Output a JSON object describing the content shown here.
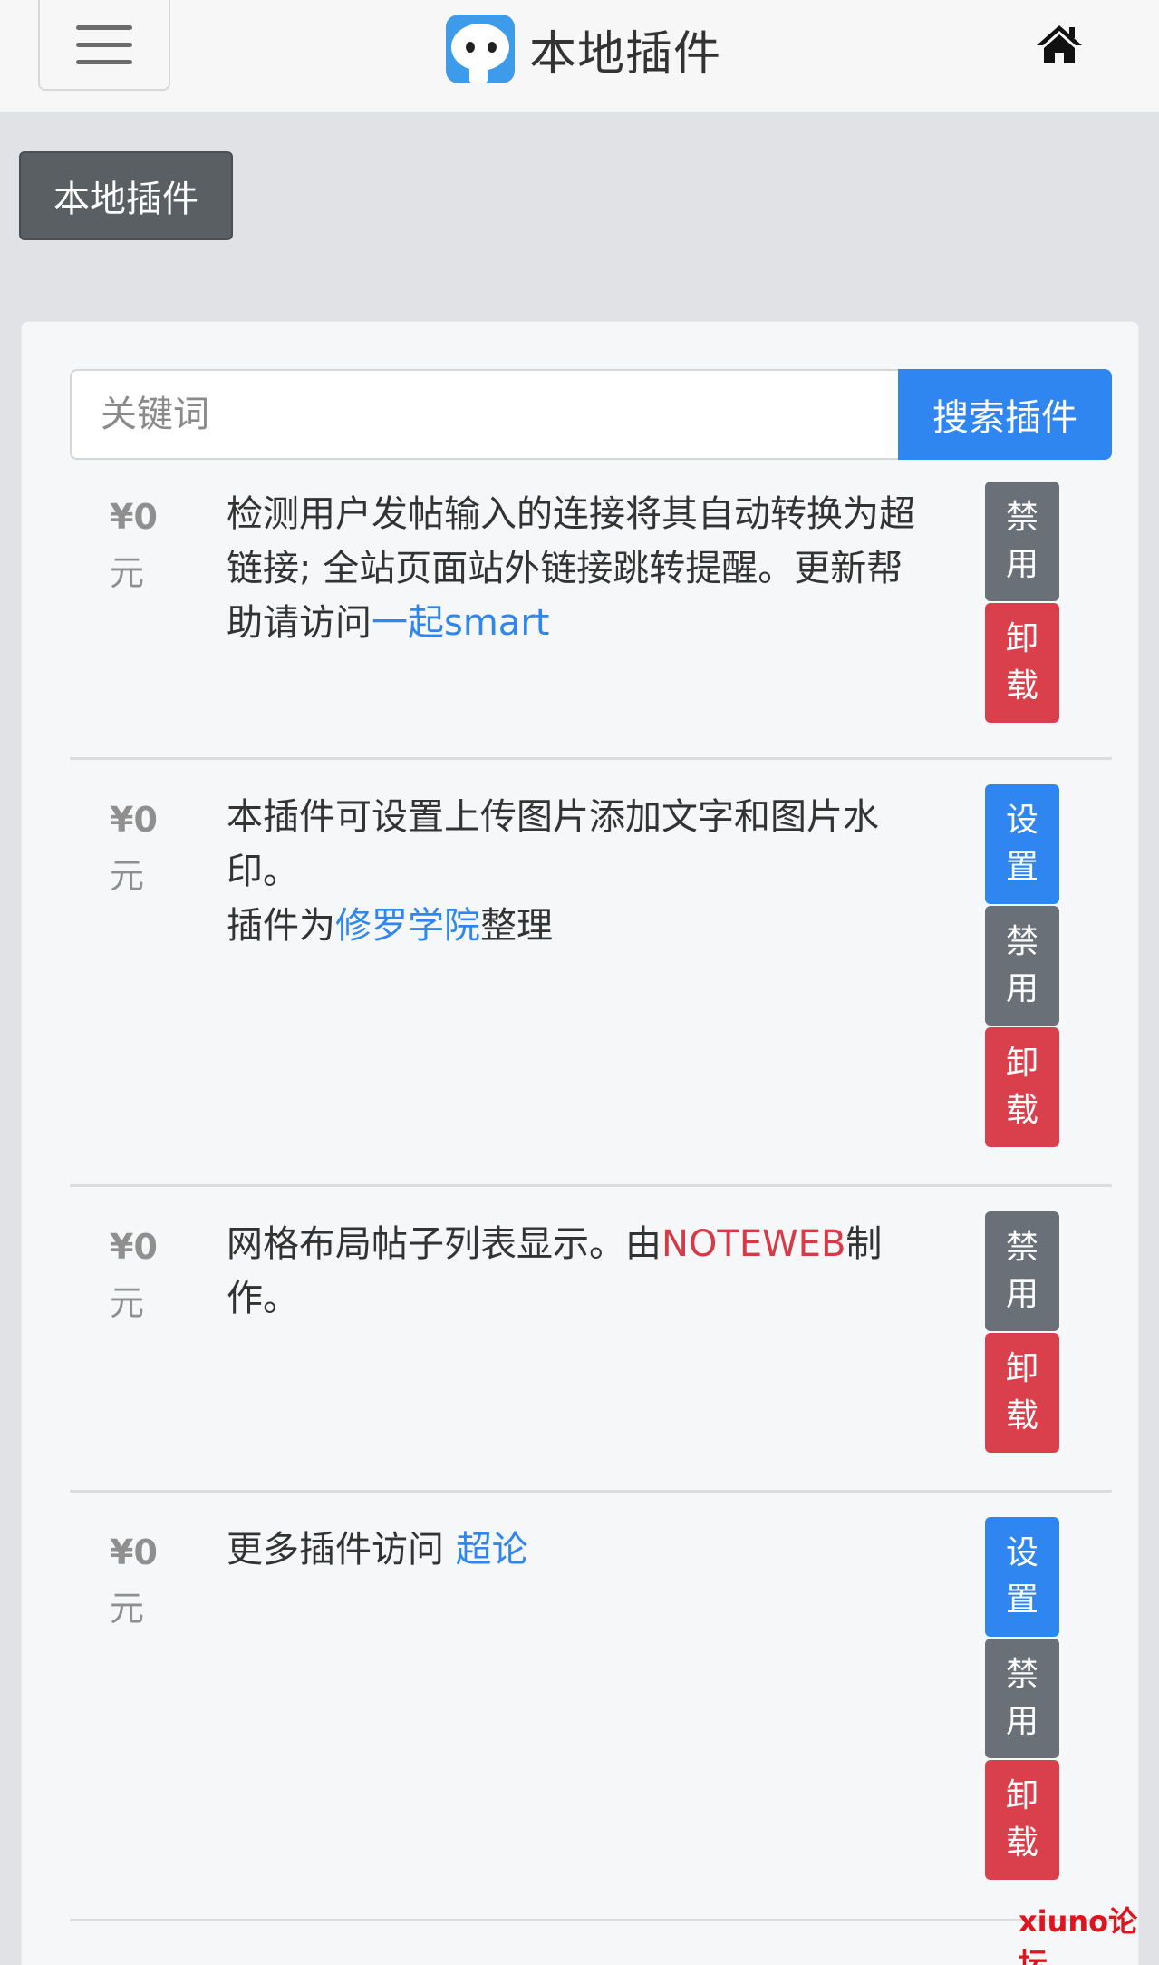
{
  "navbar": {
    "title": "本地插件",
    "menu_icon": "hamburger-menu-icon",
    "logo_icon": "chat-bubble-logo-icon",
    "home_icon": "home-icon"
  },
  "breadcrumb": {
    "label": "本地插件"
  },
  "search": {
    "placeholder": "关键词",
    "button_label": "搜索插件"
  },
  "plugins": [
    {
      "price": "¥0",
      "price_unit": "元",
      "desc_text": "检测用户发帖输入的连接将其自动转换为超链接; 全站页面站外链接跳转提醒。更新帮助请访问",
      "desc_link": "一起smart",
      "actions": [
        {
          "line1": "禁",
          "line2": "用",
          "color": "gray"
        },
        {
          "line1": "卸",
          "line2": "载",
          "color": "red"
        }
      ]
    },
    {
      "price": "¥0",
      "price_unit": "元",
      "desc_text": "本插件可设置上传图片添加文字和图片水印。",
      "desc_line2_pre": "插件为",
      "desc_link": "修罗学院",
      "desc_line2_post": "整理",
      "actions": [
        {
          "line1": "设",
          "line2": "置",
          "color": "blue"
        },
        {
          "line1": "禁",
          "line2": "用",
          "color": "gray"
        },
        {
          "line1": "卸",
          "line2": "载",
          "color": "red"
        }
      ]
    },
    {
      "price": "¥0",
      "price_unit": "元",
      "desc_pre": "网格布局帖子列表显示。由",
      "desc_link": "NOTEWEB",
      "desc_post": "制作。",
      "actions": [
        {
          "line1": "禁",
          "line2": "用",
          "color": "gray"
        },
        {
          "line1": "卸",
          "line2": "载",
          "color": "red"
        }
      ]
    },
    {
      "price": "¥0",
      "price_unit": "元",
      "desc_pre": "更多插件访问 ",
      "desc_link": "超论",
      "actions": [
        {
          "line1": "设",
          "line2": "置",
          "color": "blue"
        },
        {
          "line1": "禁",
          "line2": "用",
          "color": "gray"
        },
        {
          "line1": "卸",
          "line2": "载",
          "color": "red"
        }
      ]
    }
  ],
  "watermark": "xiuno论坛",
  "colors": {
    "primary": "#2f86f0",
    "danger": "#d9404c",
    "secondary": "#6a7077"
  }
}
